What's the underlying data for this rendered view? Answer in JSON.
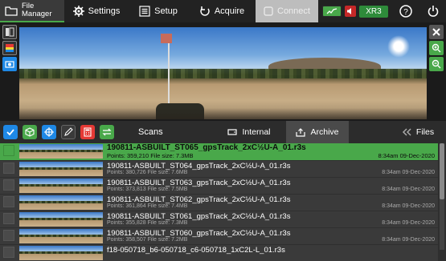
{
  "nav": {
    "file_manager": "File\nManager",
    "settings": "Settings",
    "setup": "Setup",
    "acquire": "Acquire",
    "connect": "Connect",
    "device": "XR3"
  },
  "toolbar": {
    "scans": "Scans",
    "tab_internal": "Internal",
    "tab_archive": "Archive",
    "tab_files": "Files"
  },
  "files": [
    {
      "name": "190811-ASBUILT_ST065_gpsTrack_2xC½U-A_01.r3s",
      "meta": "Points: 359,210  File size: 7.3MB",
      "date": "8:34am 09-Dec-2020",
      "selected": true
    },
    {
      "name": "190811-ASBUILT_ST064_gpsTrack_2xC½U-A_01.r3s",
      "meta": "Points: 380,726  File size: 7.6MB",
      "date": "8:34am 09-Dec-2020"
    },
    {
      "name": "190811-ASBUILT_ST063_gpsTrack_2xC½U-A_01.r3s",
      "meta": "Points: 373,813  File size: 7.5MB",
      "date": "8:34am 09-Dec-2020"
    },
    {
      "name": "190811-ASBUILT_ST062_gpsTrack_2xC½U-A_01.r3s",
      "meta": "Points: 361,864  File size: 7.4MB",
      "date": "8:34am 09-Dec-2020"
    },
    {
      "name": "190811-ASBUILT_ST061_gpsTrack_2xC½U-A_01.r3s",
      "meta": "Points: 355,828  File size: 7.3MB",
      "date": "8:34am 09-Dec-2020"
    },
    {
      "name": "190811-ASBUILT_ST060_gpsTrack_2xC½U-A_01.r3s",
      "meta": "Points: 358,507  File size: 7.2MB",
      "date": "8:34am 09-Dec-2020"
    },
    {
      "name": "f18-050718_b6-050718_c6-050718_1xC2L-L_01.r3s",
      "meta": "",
      "date": ""
    }
  ],
  "colors": {
    "accent": "#49a84a",
    "panel": "#2f2f2f",
    "alert": "#c62828",
    "info_blue": "#1e88e5"
  }
}
